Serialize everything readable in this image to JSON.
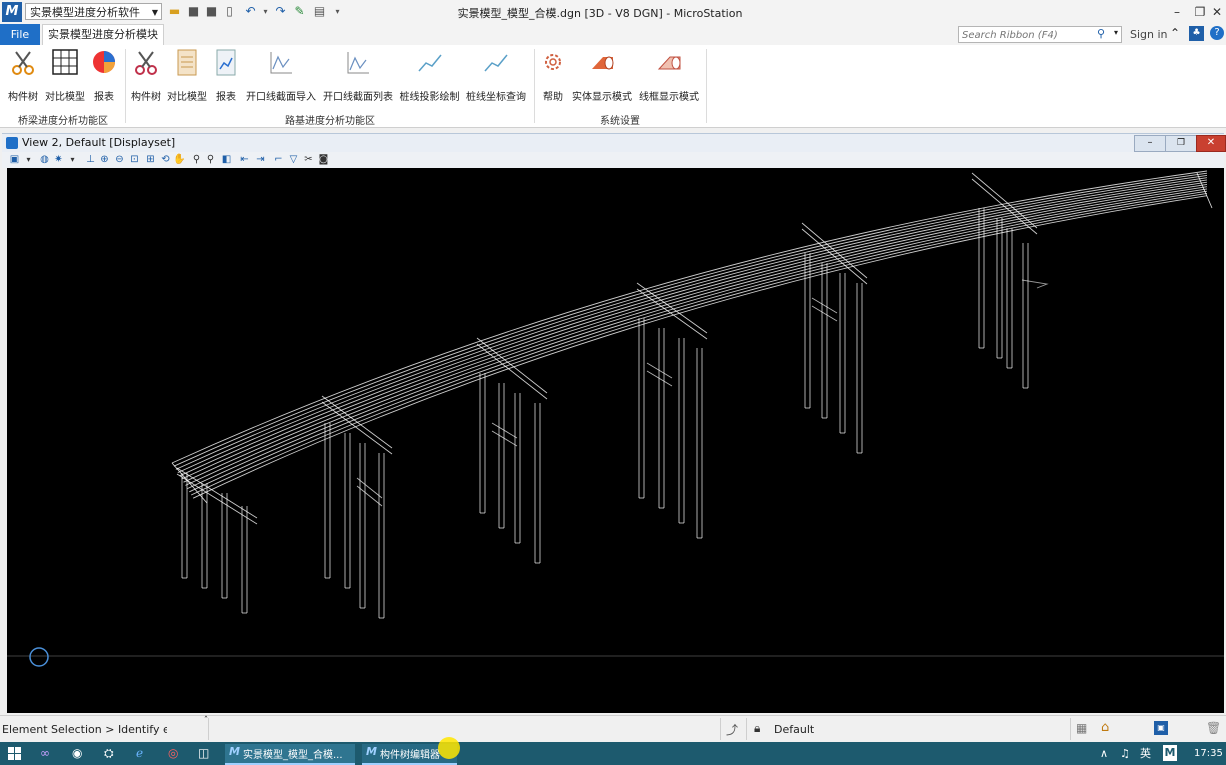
{
  "titlebar": {
    "workspace": "实景模型进度分析软件",
    "window_title": "实景模型_模型_合模.dgn [3D - V8 DGN] - MicroStation"
  },
  "tabs": {
    "file": "File",
    "active": "实景模型进度分析模块"
  },
  "search": {
    "placeholder": "Search Ribbon (F4)"
  },
  "signin": "Sign in",
  "ribbon": {
    "groups": [
      {
        "label": "桥梁进度分析功能区",
        "buttons": [
          "构件树",
          "对比模型",
          "报表"
        ]
      },
      {
        "label": "路基进度分析功能区",
        "buttons": [
          "构件树",
          "对比模型",
          "报表",
          "开口线截面导入",
          "开口线截面列表",
          "桩线投影绘制",
          "桩线坐标查询"
        ]
      },
      {
        "label": "系统设置",
        "buttons": [
          "帮助",
          "实体显示模式",
          "线框显示模式"
        ]
      }
    ]
  },
  "view": {
    "title": "View 2, Default [Displayset]"
  },
  "status": {
    "prompt": "Element Selection > Identify elem",
    "level": "Default"
  },
  "taskbar": {
    "app1": "实景模型_模型_合模...",
    "app2": "构件树编辑器",
    "ime": "英",
    "clock": "17:35"
  },
  "colors": {
    "accent": "#1f6fc7",
    "canvas": "#000000",
    "taskbar": "#1d5a6e"
  }
}
